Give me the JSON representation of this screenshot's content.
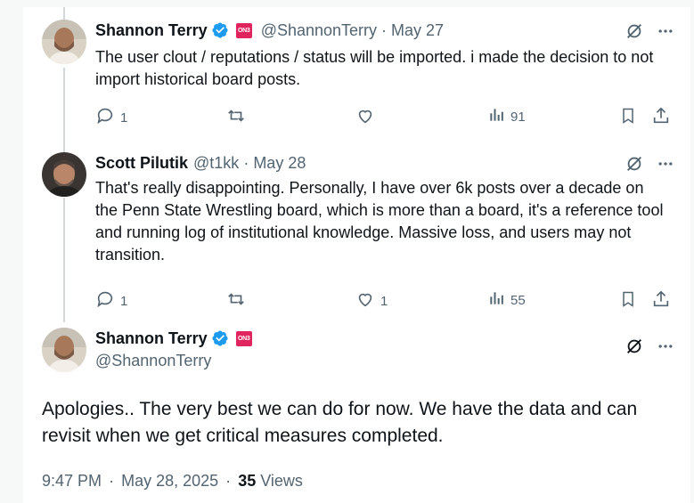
{
  "tweets": [
    {
      "name": "Shannon Terry",
      "badge": "ON3",
      "handle": "@ShannonTerry",
      "date": "May 27",
      "text": "The user clout / reputations / status will be imported. i made the decision to not import historical board posts.",
      "replies": "1",
      "retweets": "",
      "likes": "",
      "views": "91"
    },
    {
      "name": "Scott Pilutik",
      "handle": "@t1kk",
      "date": "May 28",
      "text": "That's really disappointing. Personally, I have over 6k posts over a decade on the Penn State Wrestling board, which is more than a board, it's a reference tool and running log of institutional knowledge. Massive loss, and users may not transition.",
      "replies": "1",
      "retweets": "",
      "likes": "1",
      "views": "55"
    }
  ],
  "main_tweet": {
    "name": "Shannon Terry",
    "badge": "ON3",
    "handle": "@ShannonTerry",
    "text": "Apologies.. The very best we can do for now. We have the data and can revisit when we get critical measures completed.",
    "time": "9:47 PM",
    "date": "May 28, 2025",
    "views_count": "35",
    "views_label": "Views"
  },
  "separator": "·",
  "colors": {
    "verified": "#1d9bf0",
    "badge": "#e0245e",
    "muted": "#536471",
    "thread_line": "#cfd9de"
  },
  "icons": [
    "grok-icon",
    "more-icon",
    "reply-icon",
    "retweet-icon",
    "like-icon",
    "views-icon",
    "bookmark-icon",
    "share-icon",
    "verified-icon"
  ]
}
